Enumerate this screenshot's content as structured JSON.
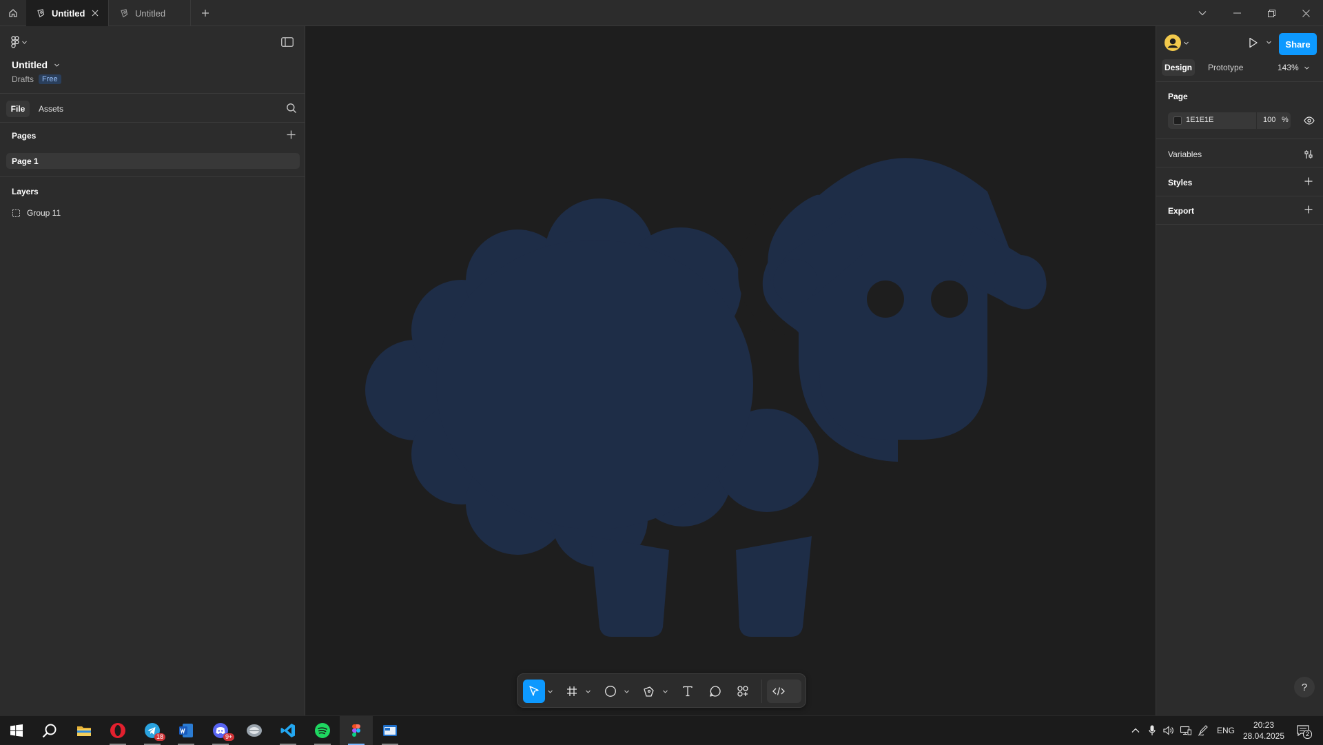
{
  "titlebar": {
    "tabs": [
      {
        "label": "Untitled",
        "active": true
      },
      {
        "label": "Untitled",
        "active": false
      }
    ]
  },
  "left_panel": {
    "file_title": "Untitled",
    "location": "Drafts",
    "plan_badge": "Free",
    "tabs": [
      "File",
      "Assets"
    ],
    "pages_heading": "Pages",
    "pages": [
      {
        "label": "Page 1",
        "selected": true
      }
    ],
    "layers_heading": "Layers",
    "layers": [
      {
        "label": "Group 11"
      }
    ]
  },
  "canvas": {
    "background": "#1e1e1e",
    "artwork_color": "#1e2d47"
  },
  "toolbar": {
    "tools": [
      "move-tool",
      "frame-tool",
      "shape-tool",
      "pen-tool",
      "text-tool",
      "comment-tool",
      "actions-tool",
      "dev-mode-toggle"
    ],
    "accent": "#0d99ff"
  },
  "right_panel": {
    "share_label": "Share",
    "tabs": [
      "Design",
      "Prototype"
    ],
    "zoom": "143%",
    "page_heading": "Page",
    "page_color_hex": "1E1E1E",
    "page_opacity": "100",
    "opacity_unit": "%",
    "sections": [
      "Variables",
      "Styles",
      "Export"
    ],
    "help": "?"
  },
  "taskbar": {
    "apps": [
      "windows-start",
      "search",
      "file-explorer",
      "opera",
      "telegram",
      "word",
      "discord",
      "app",
      "vscode",
      "spotify",
      "figma",
      "app-window"
    ],
    "telegram_badge": "18",
    "discord_badge": "9+",
    "language": "ENG",
    "time": "20:23",
    "date": "28.04.2025",
    "notifications_count": "2"
  }
}
